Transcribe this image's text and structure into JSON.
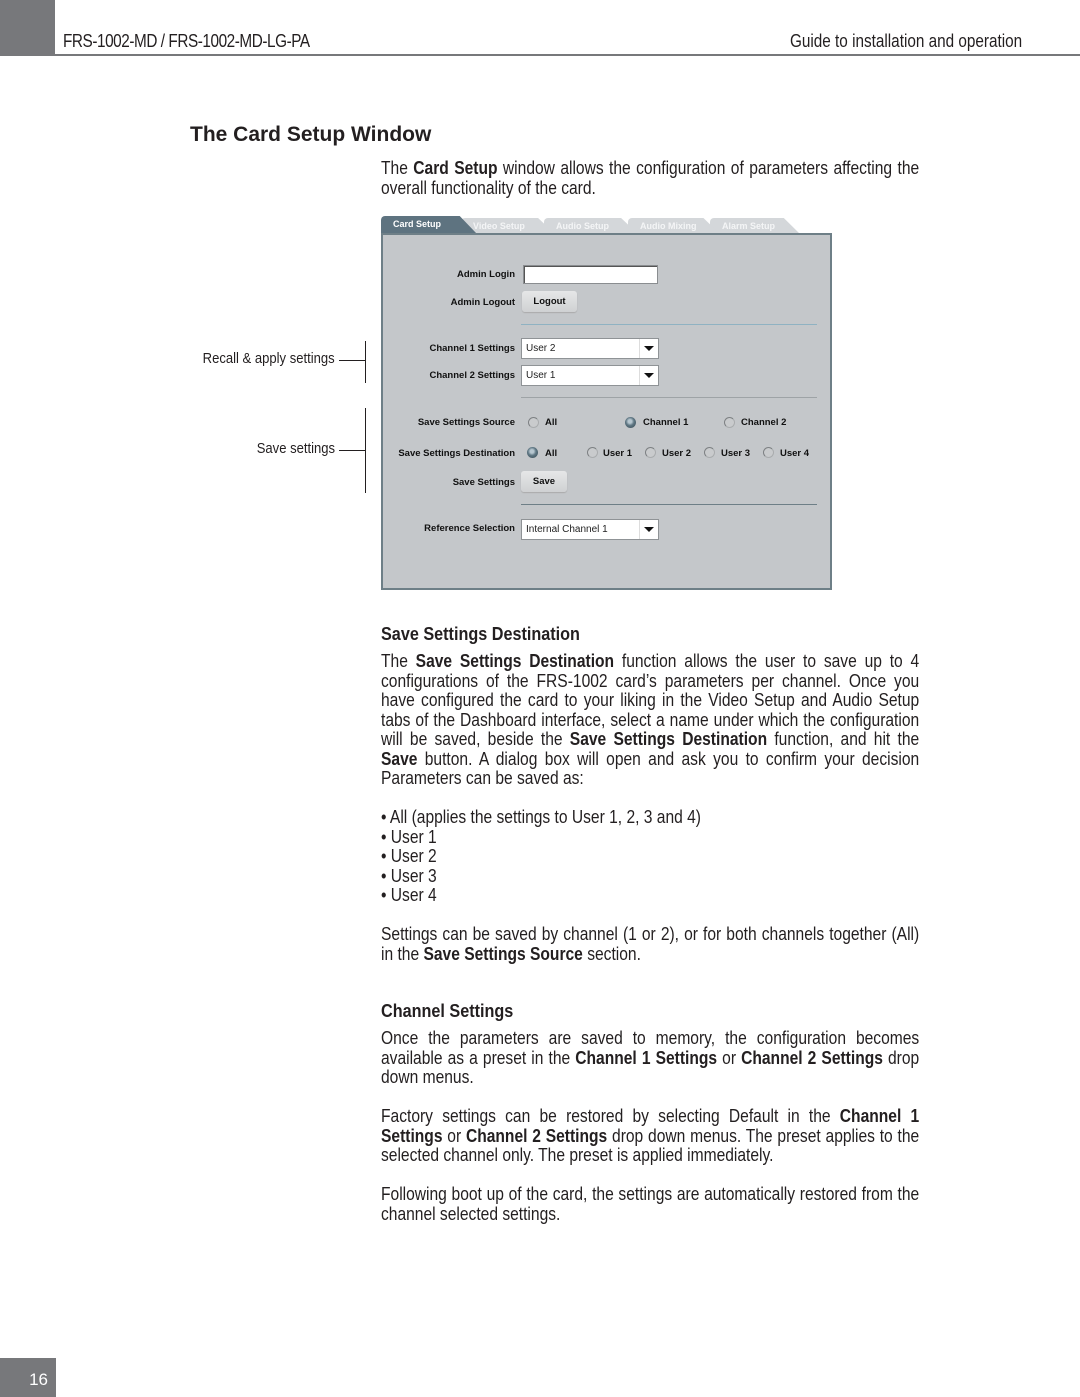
{
  "header": {
    "model": "FRS-1002-MD / FRS-1002-MD-LG-PA",
    "guide_title": "Guide to installation and operation"
  },
  "section": {
    "title": "The Card Setup Window",
    "intro_pre": "The ",
    "intro_bold": "Card Setup",
    "intro_post": " window allows the configuration of parameters affecting the overall functionality of the card."
  },
  "callouts": {
    "recall": "Recall & apply settings",
    "save": "Save settings"
  },
  "ui": {
    "tabs": [
      {
        "label": "Card Setup",
        "active": true
      },
      {
        "label": "Video Setup",
        "active": false
      },
      {
        "label": "Audio Setup",
        "active": false
      },
      {
        "label": "Audio Mixing",
        "active": false
      },
      {
        "label": "Alarm Setup",
        "active": false
      }
    ],
    "admin_login_label": "Admin Login",
    "admin_login_value": "",
    "admin_logout_label": "Admin Logout",
    "logout_button": "Logout",
    "channel1_label": "Channel 1 Settings",
    "channel1_value": "User 2",
    "channel2_label": "Channel 2 Settings",
    "channel2_value": "User 1",
    "source_label": "Save Settings Source",
    "source_options": [
      {
        "label": "All",
        "selected": false
      },
      {
        "label": "Channel 1",
        "selected": true
      },
      {
        "label": "Channel 2",
        "selected": false
      }
    ],
    "dest_label": "Save Settings Destination",
    "dest_options": [
      {
        "label": "All",
        "selected": true
      },
      {
        "label": "User 1",
        "selected": false
      },
      {
        "label": "User 2",
        "selected": false
      },
      {
        "label": "User 3",
        "selected": false
      },
      {
        "label": "User 4",
        "selected": false
      }
    ],
    "save_settings_label": "Save Settings",
    "save_button": "Save",
    "reference_label": "Reference Selection",
    "reference_value": "Internal Channel 1"
  },
  "save_dest": {
    "heading": "Save Settings Destination",
    "p1": [
      {
        "t": "The ",
        "b": false
      },
      {
        "t": "Save Settings Destination",
        "b": true
      },
      {
        "t": " function allows the user to save up to 4 configurations of the FRS-1002 card’s parameters per channel. Once you have configured the card to your liking in the Video Setup and Audio Setup tabs of the Dashboard interface, select a name under which the configuration will be saved, beside the ",
        "b": false
      },
      {
        "t": "Save Settings Destination",
        "b": true
      },
      {
        "t": " function, and hit the ",
        "b": false
      },
      {
        "t": "Save",
        "b": true
      },
      {
        "t": " button. A dialog box will open and ask you to confirm your decision  Parameters can be saved as:",
        "b": false
      }
    ],
    "bullets": [
      "All (applies the settings to User 1, 2, 3 and 4)",
      "User 1",
      "User 2",
      "User 3",
      "User 4"
    ],
    "p2": [
      {
        "t": "Settings can be saved by channel (1 or 2), or for both channels together (All) in the ",
        "b": false
      },
      {
        "t": "Save Settings Source",
        "b": true
      },
      {
        "t": " section.",
        "b": false
      }
    ]
  },
  "channel_settings": {
    "heading": "Channel Settings",
    "p1": [
      {
        "t": "Once the parameters are saved to memory, the configuration becomes available as a preset in the ",
        "b": false
      },
      {
        "t": "Channel 1 Settings",
        "b": true
      },
      {
        "t": " or ",
        "b": false
      },
      {
        "t": "Channel 2 Settings",
        "b": true
      },
      {
        "t": " drop down menus.",
        "b": false
      }
    ],
    "p2": [
      {
        "t": "Factory settings can be restored by selecting Default in the ",
        "b": false
      },
      {
        "t": "Channel 1 Settings",
        "b": true
      },
      {
        "t": " or ",
        "b": false
      },
      {
        "t": "Channel 2 Settings",
        "b": true
      },
      {
        "t": " drop down menus. The preset applies to the selected channel only. The preset is applied immediately.",
        "b": false
      }
    ],
    "p3": [
      {
        "t": "Following boot up of the card, the settings are automatically restored from the channel selected settings.",
        "b": false
      }
    ]
  },
  "footer": {
    "page_number": "16"
  }
}
